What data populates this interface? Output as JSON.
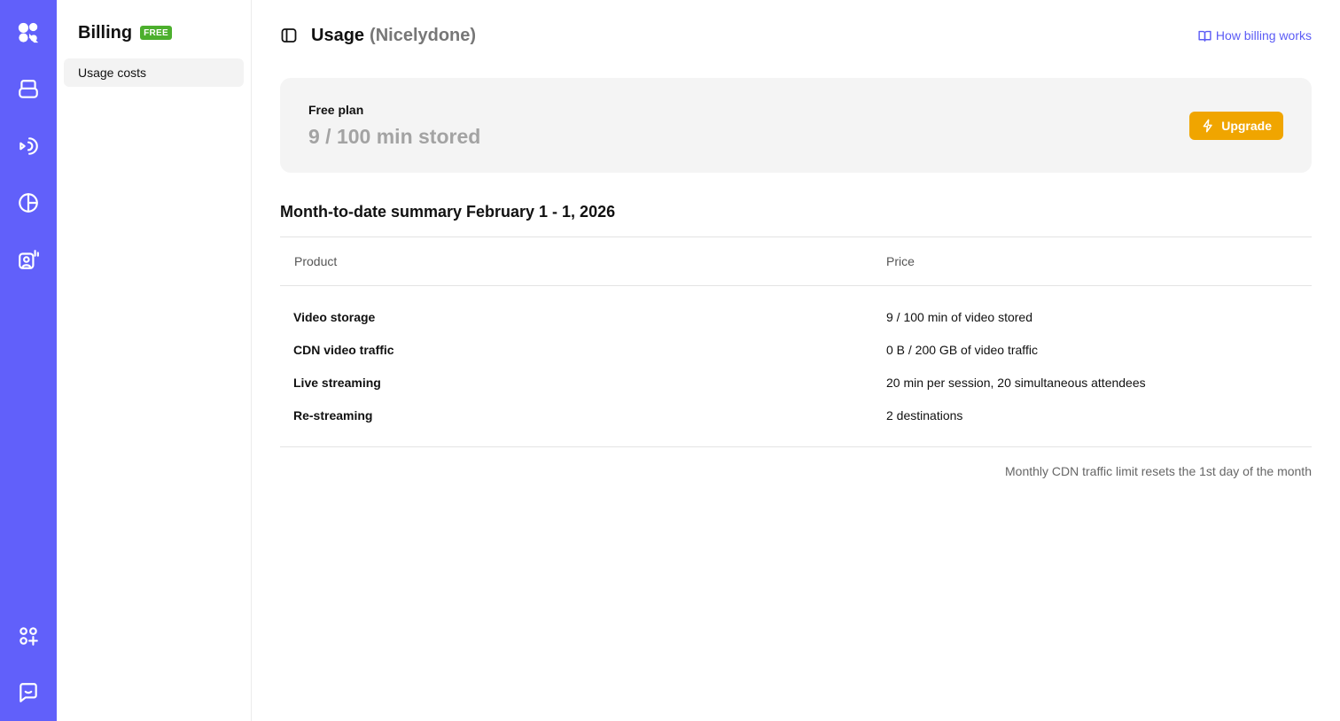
{
  "rail": {
    "icons": [
      "logo-icon",
      "storage-icon",
      "live-stream-icon",
      "analytics-icon",
      "ai-studio-icon",
      "apps-icon",
      "chat-icon"
    ]
  },
  "sidebar": {
    "title": "Billing",
    "badge": "FREE",
    "items": [
      {
        "label": "Usage costs",
        "active": true
      }
    ]
  },
  "header": {
    "title": "Usage",
    "subtitle": "(Nicelydone)",
    "help_link": "How billing works"
  },
  "plan": {
    "label": "Free plan",
    "value": "9 / 100 min stored",
    "upgrade_label": "Upgrade"
  },
  "summary": {
    "title": "Month-to-date summary February 1 - 1, 2026",
    "columns": [
      "Product",
      "Price"
    ],
    "rows": [
      {
        "product": "Video storage",
        "price": "9 / 100 min of video stored"
      },
      {
        "product": "CDN video traffic",
        "price": "0 B / 200 GB of video traffic"
      },
      {
        "product": "Live streaming",
        "price": "20 min per session, 20 simultaneous attendees"
      },
      {
        "product": "Re-streaming",
        "price": "2 destinations"
      }
    ],
    "footnote": "Monthly CDN traffic limit resets the 1st day of the month"
  },
  "colors": {
    "rail_bg": "#6160fa",
    "accent_link": "#5b5bf5",
    "upgrade_bg": "#f0a500",
    "free_badge": "#4caf2d"
  }
}
